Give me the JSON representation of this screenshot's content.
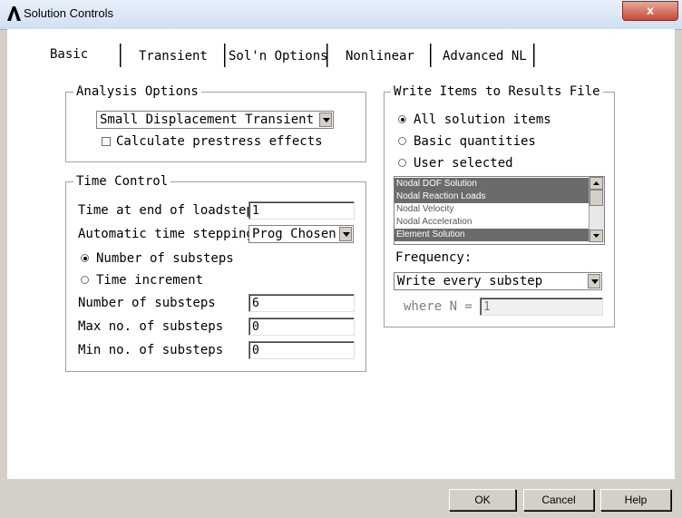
{
  "window": {
    "title": "Solution Controls",
    "close_label": "x"
  },
  "tabs": [
    {
      "label": "Basic"
    },
    {
      "label": "Transient"
    },
    {
      "label": "Sol'n Options"
    },
    {
      "label": "Nonlinear"
    },
    {
      "label": "Advanced NL"
    }
  ],
  "analysis_options": {
    "title": "Analysis Options",
    "analysis_type": "Small Displacement Transient",
    "prestress_label": "Calculate prestress effects",
    "prestress_checked": false
  },
  "time_control": {
    "title": "Time Control",
    "time_end_label": "Time at end of loadstep",
    "time_end_value": "1",
    "auto_step_label": "Automatic time stepping",
    "auto_step_value": "Prog Chosen",
    "radio_substeps_label": "Number of substeps",
    "radio_increment_label": "Time increment",
    "num_substeps_label": "Number of substeps",
    "num_substeps_value": "6",
    "max_substeps_label": "Max no. of substeps",
    "max_substeps_value": "0",
    "min_substeps_label": "Min no. of substeps",
    "min_substeps_value": "0"
  },
  "write_items": {
    "title": "Write Items to Results File",
    "opt_all": "All solution items",
    "opt_basic": "Basic quantities",
    "opt_user": "User selected",
    "list_items": [
      "Nodal DOF Solution",
      "Nodal Reaction Loads",
      "Nodal Velocity",
      "Nodal Acceleration",
      "Element Solution"
    ],
    "frequency_label": "Frequency:",
    "frequency_value": "Write every substep",
    "where_label": "where N =",
    "where_value": "1"
  },
  "buttons": {
    "ok": "OK",
    "cancel": "Cancel",
    "help": "Help"
  }
}
